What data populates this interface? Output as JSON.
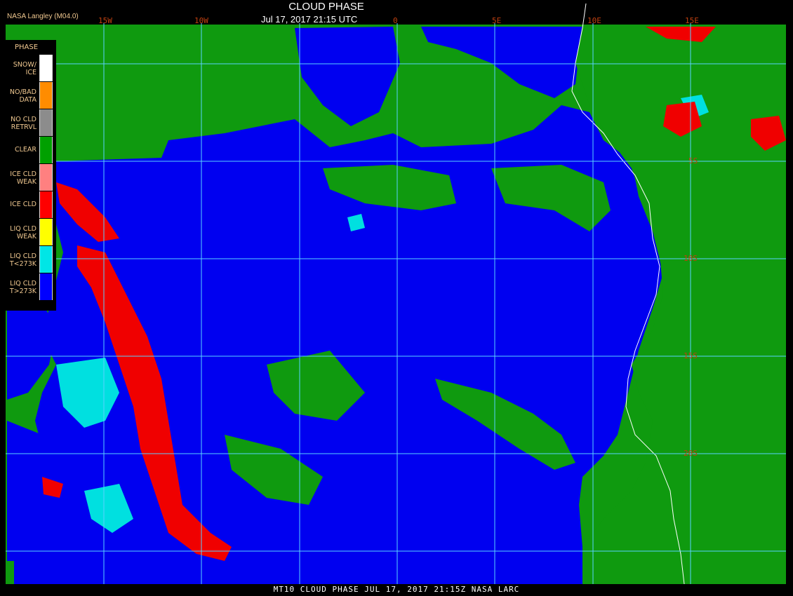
{
  "header": {
    "title": "CLOUD PHASE",
    "subtitle": "Jul 17, 2017 21:15 UTC",
    "agency": "NASA Langley (M04.0)"
  },
  "longitude_labels": [
    "15W",
    "10W",
    "0",
    "5E",
    "10E",
    "15E"
  ],
  "latitude_labels": [
    "5S",
    "10S",
    "15S",
    "20S"
  ],
  "legend": {
    "title": "PHASE",
    "items": [
      {
        "label": [
          "SNOW/",
          "ICE"
        ],
        "color": "#ffffff"
      },
      {
        "label": [
          "NO/BAD",
          "DATA"
        ],
        "color": "#ff8c00"
      },
      {
        "label": [
          "NO CLD",
          "RETRVL"
        ],
        "color": "#8c8c8c"
      },
      {
        "label": [
          "CLEAR"
        ],
        "color": "#00a000"
      },
      {
        "label": [
          "ICE CLD",
          "WEAK"
        ],
        "color": "#ff8080"
      },
      {
        "label": [
          "ICE CLD"
        ],
        "color": "#ff0000"
      },
      {
        "label": [
          "LIQ CLD",
          "WEAK"
        ],
        "color": "#ffff00"
      },
      {
        "label": [
          "LIQ CLD",
          "T<273K"
        ],
        "color": "#00e6e6"
      },
      {
        "label": [
          "LIQ CLD",
          "T>273K"
        ],
        "color": "#0000ff"
      }
    ]
  },
  "colors": {
    "clear": "#0f9a0f",
    "liquid_warm": "#0000f0",
    "liquid_cold": "#00e0e0",
    "ice": "#ff0000",
    "grid": "#5ad2ff",
    "coastline": "#ffffff"
  },
  "footer": "MT10  CLOUD PHASE  JUL 17, 2017 21:15Z  NASA LARC"
}
